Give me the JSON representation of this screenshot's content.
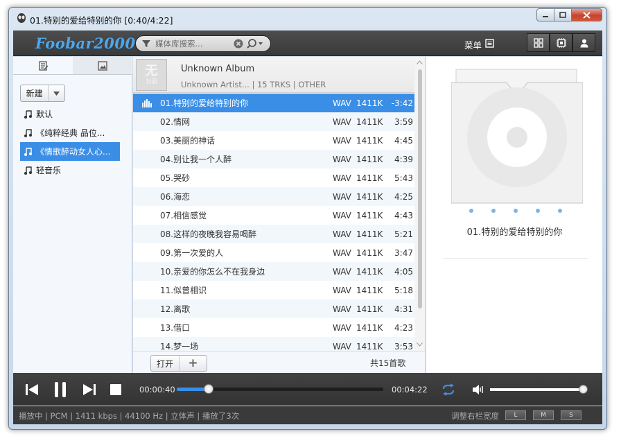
{
  "window": {
    "title": "01.特别的爱给特别的你 [0:40/4:22]",
    "controls": {
      "minimize": "_",
      "maximize": "□",
      "close": "x"
    }
  },
  "topbar": {
    "logo": "Foobar2000",
    "search_placeholder": "媒体库搜索...",
    "menu_label": "菜单",
    "icons": [
      "filter-icon",
      "clear-icon",
      "search-icon",
      "menu-icon",
      "grid-view-icon",
      "chip-view-icon",
      "user-icon"
    ]
  },
  "sidebar": {
    "tabs": [
      "playlist-tab-icon",
      "album-art-tab-icon"
    ],
    "new_button": "新建",
    "playlists": [
      {
        "label": "默认",
        "active": false
      },
      {
        "label": "《纯粹经典 品位...",
        "active": false
      },
      {
        "label": "《情歌醉动女人心...",
        "active": true
      },
      {
        "label": "轻音乐",
        "active": false
      }
    ]
  },
  "album": {
    "cover_text": "无",
    "cover_subtext": "封面",
    "title": "Unknown Album",
    "subtitle": "Unknown Artist... | 15 TRKS | OTHER"
  },
  "tracks": [
    {
      "name": "01.特别的爱给特别的你",
      "format": "WAV",
      "bitrate": "1411K",
      "duration": "-3:42",
      "playing": true
    },
    {
      "name": "02.情网",
      "format": "WAV",
      "bitrate": "1411K",
      "duration": "3:59"
    },
    {
      "name": "03.美丽的神话",
      "format": "WAV",
      "bitrate": "1411K",
      "duration": "4:45"
    },
    {
      "name": "04.别让我一个人醉",
      "format": "WAV",
      "bitrate": "1411K",
      "duration": "4:39"
    },
    {
      "name": "05.哭砂",
      "format": "WAV",
      "bitrate": "1411K",
      "duration": "5:43"
    },
    {
      "name": "06.海恋",
      "format": "WAV",
      "bitrate": "1411K",
      "duration": "4:25"
    },
    {
      "name": "07.相信感觉",
      "format": "WAV",
      "bitrate": "1411K",
      "duration": "4:43"
    },
    {
      "name": "08.这样的夜晚我容易喝醉",
      "format": "WAV",
      "bitrate": "1411K",
      "duration": "5:21"
    },
    {
      "name": "09.第一次爱的人",
      "format": "WAV",
      "bitrate": "1411K",
      "duration": "3:47"
    },
    {
      "name": "10.亲爱的你怎么不在我身边",
      "format": "WAV",
      "bitrate": "1411K",
      "duration": "4:05"
    },
    {
      "name": "11.似曾相识",
      "format": "WAV",
      "bitrate": "1411K",
      "duration": "5:18"
    },
    {
      "name": "12.离歌",
      "format": "WAV",
      "bitrate": "1411K",
      "duration": "4:31"
    },
    {
      "name": "13.借口",
      "format": "WAV",
      "bitrate": "1411K",
      "duration": "4:23"
    },
    {
      "name": "14.梦一场",
      "format": "WAV",
      "bitrate": "1411K",
      "duration": "3:53"
    }
  ],
  "list_footer": {
    "open_button": "打开",
    "add_button": "+",
    "total": "共15首歌"
  },
  "now_playing": {
    "title": "01.特别的爱给特别的你"
  },
  "player": {
    "elapsed": "00:00:40",
    "total": "00:04:22",
    "progress_fraction": 0.153,
    "volume_fraction": 1.0,
    "accent": "#3a8ee6"
  },
  "status": {
    "text": "播放中 | PCM | 1411 kbps | 44100 Hz | 立体声 | 播放了3次",
    "adjust_label": "调整右栏宽度",
    "size_buttons": [
      "L",
      "M",
      "S"
    ]
  }
}
